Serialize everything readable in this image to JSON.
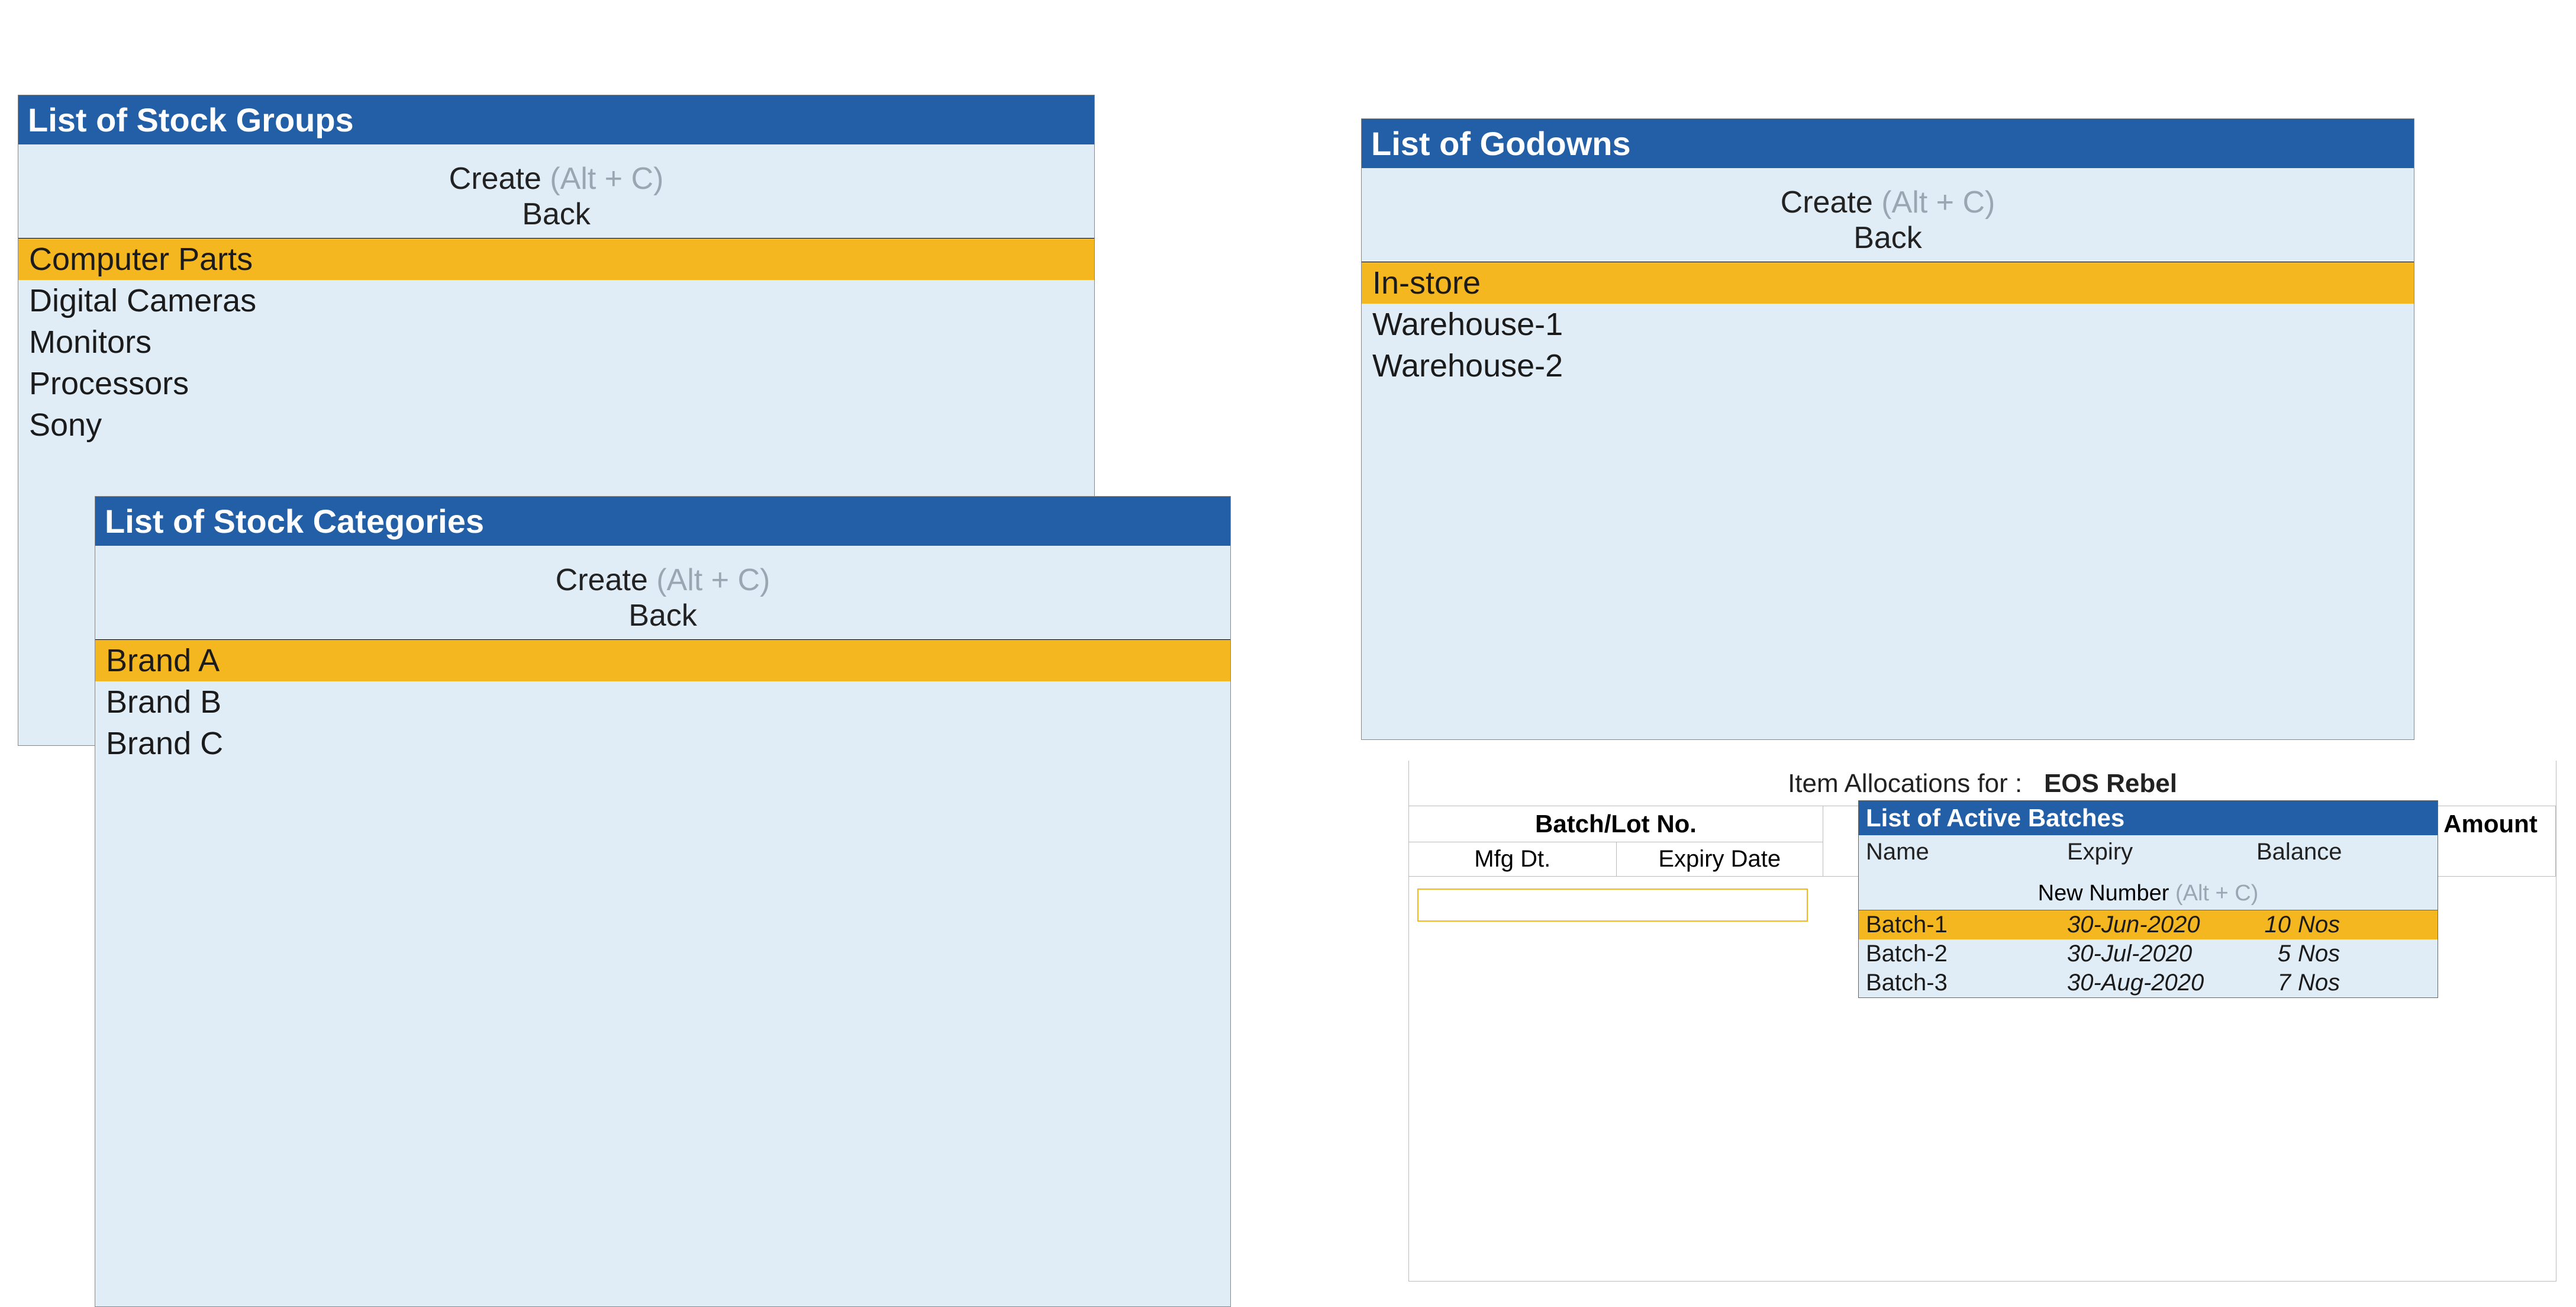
{
  "stock_groups": {
    "title": "List of Stock Groups",
    "create_label": "Create",
    "create_shortcut": "(Alt + C)",
    "back_label": "Back",
    "selected_index": 0,
    "items": [
      "Computer Parts",
      "Digital Cameras",
      "Monitors",
      "Processors",
      "Sony"
    ]
  },
  "stock_categories": {
    "title": "List of Stock Categories",
    "create_label": "Create",
    "create_shortcut": "(Alt + C)",
    "back_label": "Back",
    "selected_index": 0,
    "items": [
      "Brand A",
      "Brand B",
      "Brand C"
    ]
  },
  "godowns": {
    "title": "List of Godowns",
    "create_label": "Create",
    "create_shortcut": "(Alt + C)",
    "back_label": "Back",
    "selected_index": 0,
    "items": [
      "In-store",
      "Warehouse-1",
      "Warehouse-2"
    ]
  },
  "item_alloc": {
    "title_prefix": "Item Allocations for :",
    "item_name": "EOS Rebel",
    "col_batch": "Batch/Lot No.",
    "col_mfg": "Mfg Dt.",
    "col_expiry": "Expiry Date",
    "col_amount": "Amount"
  },
  "active_batches": {
    "title": "List of Active Batches",
    "col_name": "Name",
    "col_expiry": "Expiry",
    "col_balance": "Balance",
    "newnum_label": "New Number",
    "newnum_shortcut": "(Alt + C)",
    "selected_index": 0,
    "rows": [
      {
        "name": "Batch-1",
        "expiry": "30-Jun-2020",
        "qty": "10",
        "unit": "Nos"
      },
      {
        "name": "Batch-2",
        "expiry": "30-Jul-2020",
        "qty": "5",
        "unit": "Nos"
      },
      {
        "name": "Batch-3",
        "expiry": "30-Aug-2020",
        "qty": "7",
        "unit": "Nos"
      }
    ]
  }
}
